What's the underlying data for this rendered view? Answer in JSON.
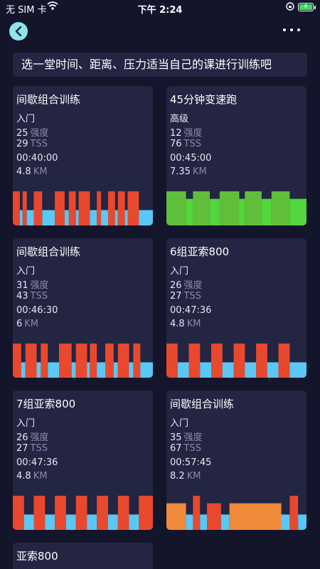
{
  "status_bar": {
    "carrier": "无 SIM 卡",
    "time": "下午 2:24"
  },
  "banner": "选一堂时间、距离、压力适当自己的课进行训练吧",
  "units": {
    "intensity": "强度",
    "tss": "TSS",
    "distance": "KM"
  },
  "workouts": [
    {
      "title": "间歇组合训练",
      "level": "入门",
      "intensity": "25",
      "tss": "29",
      "duration": "00:40:00",
      "distance": "4.8",
      "bars": [
        {
          "from": 0.0,
          "to": 0.05,
          "level": 1.0,
          "color": "#e8492e"
        },
        {
          "from": 0.05,
          "to": 0.07,
          "level": 0.45,
          "color": "#5ac8f5"
        },
        {
          "from": 0.07,
          "to": 0.1,
          "level": 1.0,
          "color": "#e8492e"
        },
        {
          "from": 0.1,
          "to": 0.15,
          "level": 0.45,
          "color": "#5ac8f5"
        },
        {
          "from": 0.15,
          "to": 0.21,
          "level": 1.0,
          "color": "#e8492e"
        },
        {
          "from": 0.21,
          "to": 0.3,
          "level": 0.45,
          "color": "#5ac8f5"
        },
        {
          "from": 0.3,
          "to": 0.37,
          "level": 1.0,
          "color": "#e8492e"
        },
        {
          "from": 0.37,
          "to": 0.4,
          "level": 0.45,
          "color": "#5ac8f5"
        },
        {
          "from": 0.4,
          "to": 0.45,
          "level": 1.0,
          "color": "#e8492e"
        },
        {
          "from": 0.45,
          "to": 0.47,
          "level": 0.45,
          "color": "#5ac8f5"
        },
        {
          "from": 0.47,
          "to": 0.55,
          "level": 1.0,
          "color": "#e8492e"
        },
        {
          "from": 0.55,
          "to": 0.6,
          "level": 0.45,
          "color": "#5ac8f5"
        },
        {
          "from": 0.6,
          "to": 0.63,
          "level": 1.0,
          "color": "#e8492e"
        },
        {
          "from": 0.63,
          "to": 0.68,
          "level": 0.45,
          "color": "#5ac8f5"
        },
        {
          "from": 0.68,
          "to": 0.73,
          "level": 1.0,
          "color": "#e8492e"
        },
        {
          "from": 0.73,
          "to": 0.75,
          "level": 0.45,
          "color": "#5ac8f5"
        },
        {
          "from": 0.75,
          "to": 0.8,
          "level": 1.0,
          "color": "#e8492e"
        },
        {
          "from": 0.8,
          "to": 0.82,
          "level": 0.45,
          "color": "#5ac8f5"
        },
        {
          "from": 0.82,
          "to": 0.9,
          "level": 1.0,
          "color": "#e8492e"
        },
        {
          "from": 0.9,
          "to": 1.0,
          "level": 0.45,
          "color": "#5ac8f5"
        }
      ]
    },
    {
      "title": "45分钟变速跑",
      "level": "高级",
      "intensity": "12",
      "tss": "76",
      "duration": "00:45:00",
      "distance": "7.35",
      "bars": [
        {
          "from": 0.0,
          "to": 0.14,
          "level": 1.0,
          "color": "#5fbf3a"
        },
        {
          "from": 0.14,
          "to": 0.19,
          "level": 0.78,
          "color": "#52d63e"
        },
        {
          "from": 0.19,
          "to": 0.31,
          "level": 1.0,
          "color": "#5fbf3a"
        },
        {
          "from": 0.31,
          "to": 0.38,
          "level": 0.78,
          "color": "#52d63e"
        },
        {
          "from": 0.38,
          "to": 0.52,
          "level": 1.0,
          "color": "#5fbf3a"
        },
        {
          "from": 0.52,
          "to": 0.56,
          "level": 0.78,
          "color": "#52d63e"
        },
        {
          "from": 0.56,
          "to": 0.68,
          "level": 1.0,
          "color": "#5fbf3a"
        },
        {
          "from": 0.68,
          "to": 0.75,
          "level": 0.78,
          "color": "#52d63e"
        },
        {
          "from": 0.75,
          "to": 0.88,
          "level": 1.0,
          "color": "#5fbf3a"
        },
        {
          "from": 0.88,
          "to": 1.0,
          "level": 0.78,
          "color": "#52d63e"
        }
      ]
    },
    {
      "title": "间歇组合训练",
      "level": "入门",
      "intensity": "31",
      "tss": "43",
      "duration": "00:46:30",
      "distance": "6",
      "bars": [
        {
          "from": 0.0,
          "to": 0.06,
          "level": 1.0,
          "color": "#e8492e"
        },
        {
          "from": 0.06,
          "to": 0.09,
          "level": 0.45,
          "color": "#5ac8f5"
        },
        {
          "from": 0.09,
          "to": 0.17,
          "level": 1.0,
          "color": "#e8492e"
        },
        {
          "from": 0.17,
          "to": 0.2,
          "level": 0.45,
          "color": "#5ac8f5"
        },
        {
          "from": 0.2,
          "to": 0.25,
          "level": 1.0,
          "color": "#e8492e"
        },
        {
          "from": 0.25,
          "to": 0.33,
          "level": 0.45,
          "color": "#5ac8f5"
        },
        {
          "from": 0.33,
          "to": 0.42,
          "level": 1.0,
          "color": "#e8492e"
        },
        {
          "from": 0.42,
          "to": 0.45,
          "level": 0.45,
          "color": "#5ac8f5"
        },
        {
          "from": 0.45,
          "to": 0.53,
          "level": 1.0,
          "color": "#e8492e"
        },
        {
          "from": 0.53,
          "to": 0.55,
          "level": 0.45,
          "color": "#5ac8f5"
        },
        {
          "from": 0.55,
          "to": 0.6,
          "level": 1.0,
          "color": "#e8492e"
        },
        {
          "from": 0.6,
          "to": 0.66,
          "level": 0.45,
          "color": "#5ac8f5"
        },
        {
          "from": 0.66,
          "to": 0.72,
          "level": 1.0,
          "color": "#e8492e"
        },
        {
          "from": 0.72,
          "to": 0.75,
          "level": 0.45,
          "color": "#5ac8f5"
        },
        {
          "from": 0.75,
          "to": 0.83,
          "level": 1.0,
          "color": "#e8492e"
        },
        {
          "from": 0.83,
          "to": 0.86,
          "level": 0.45,
          "color": "#5ac8f5"
        },
        {
          "from": 0.86,
          "to": 0.91,
          "level": 1.0,
          "color": "#e8492e"
        },
        {
          "from": 0.91,
          "to": 1.0,
          "level": 0.45,
          "color": "#5ac8f5"
        }
      ]
    },
    {
      "title": "6组亚索800",
      "level": "入门",
      "intensity": "26",
      "tss": "27",
      "duration": "00:47:36",
      "distance": "4.8",
      "bars": [
        {
          "from": 0.0,
          "to": 0.08,
          "level": 1.0,
          "color": "#e8492e"
        },
        {
          "from": 0.08,
          "to": 0.16,
          "level": 0.45,
          "color": "#5ac8f5"
        },
        {
          "from": 0.16,
          "to": 0.24,
          "level": 1.0,
          "color": "#e8492e"
        },
        {
          "from": 0.24,
          "to": 0.32,
          "level": 0.45,
          "color": "#5ac8f5"
        },
        {
          "from": 0.32,
          "to": 0.4,
          "level": 1.0,
          "color": "#e8492e"
        },
        {
          "from": 0.4,
          "to": 0.48,
          "level": 0.45,
          "color": "#5ac8f5"
        },
        {
          "from": 0.48,
          "to": 0.56,
          "level": 1.0,
          "color": "#e8492e"
        },
        {
          "from": 0.56,
          "to": 0.64,
          "level": 0.45,
          "color": "#5ac8f5"
        },
        {
          "from": 0.64,
          "to": 0.72,
          "level": 1.0,
          "color": "#e8492e"
        },
        {
          "from": 0.72,
          "to": 0.8,
          "level": 0.45,
          "color": "#5ac8f5"
        },
        {
          "from": 0.8,
          "to": 0.88,
          "level": 1.0,
          "color": "#e8492e"
        },
        {
          "from": 0.88,
          "to": 1.0,
          "level": 0.45,
          "color": "#5ac8f5"
        }
      ]
    },
    {
      "title": "7组亚索800",
      "level": "入门",
      "intensity": "26",
      "tss": "27",
      "duration": "00:47:36",
      "distance": "4.8",
      "bars": [
        {
          "from": 0.0,
          "to": 0.08,
          "level": 1.0,
          "color": "#e8492e"
        },
        {
          "from": 0.08,
          "to": 0.15,
          "level": 0.45,
          "color": "#5ac8f5"
        },
        {
          "from": 0.15,
          "to": 0.23,
          "level": 1.0,
          "color": "#e8492e"
        },
        {
          "from": 0.23,
          "to": 0.3,
          "level": 0.45,
          "color": "#5ac8f5"
        },
        {
          "from": 0.3,
          "to": 0.38,
          "level": 1.0,
          "color": "#e8492e"
        },
        {
          "from": 0.38,
          "to": 0.45,
          "level": 0.45,
          "color": "#5ac8f5"
        },
        {
          "from": 0.45,
          "to": 0.53,
          "level": 1.0,
          "color": "#e8492e"
        },
        {
          "from": 0.53,
          "to": 0.6,
          "level": 0.45,
          "color": "#5ac8f5"
        },
        {
          "from": 0.6,
          "to": 0.68,
          "level": 1.0,
          "color": "#e8492e"
        },
        {
          "from": 0.68,
          "to": 0.75,
          "level": 0.45,
          "color": "#5ac8f5"
        },
        {
          "from": 0.75,
          "to": 0.83,
          "level": 1.0,
          "color": "#e8492e"
        },
        {
          "from": 0.83,
          "to": 0.9,
          "level": 0.45,
          "color": "#5ac8f5"
        },
        {
          "from": 0.9,
          "to": 1.0,
          "level": 1.0,
          "color": "#e8492e"
        }
      ]
    },
    {
      "title": "间歇组合训练",
      "level": "入门",
      "intensity": "35",
      "tss": "67",
      "duration": "00:57:45",
      "distance": "8.2",
      "bars": [
        {
          "from": 0.0,
          "to": 0.14,
          "level": 0.78,
          "color": "#ef8a3a"
        },
        {
          "from": 0.14,
          "to": 0.19,
          "level": 0.45,
          "color": "#5ac8f5"
        },
        {
          "from": 0.19,
          "to": 0.24,
          "level": 1.0,
          "color": "#e8492e"
        },
        {
          "from": 0.24,
          "to": 0.29,
          "level": 0.45,
          "color": "#5ac8f5"
        },
        {
          "from": 0.29,
          "to": 0.39,
          "level": 0.78,
          "color": "#e8492e"
        },
        {
          "from": 0.39,
          "to": 0.45,
          "level": 0.45,
          "color": "#5ac8f5"
        },
        {
          "from": 0.45,
          "to": 0.82,
          "level": 0.78,
          "color": "#ef8a3a"
        },
        {
          "from": 0.82,
          "to": 0.88,
          "level": 0.45,
          "color": "#5ac8f5"
        },
        {
          "from": 0.88,
          "to": 0.94,
          "level": 1.0,
          "color": "#e8492e"
        },
        {
          "from": 0.94,
          "to": 1.0,
          "level": 0.45,
          "color": "#5ac8f5"
        }
      ]
    },
    {
      "title": "亚索800"
    }
  ]
}
